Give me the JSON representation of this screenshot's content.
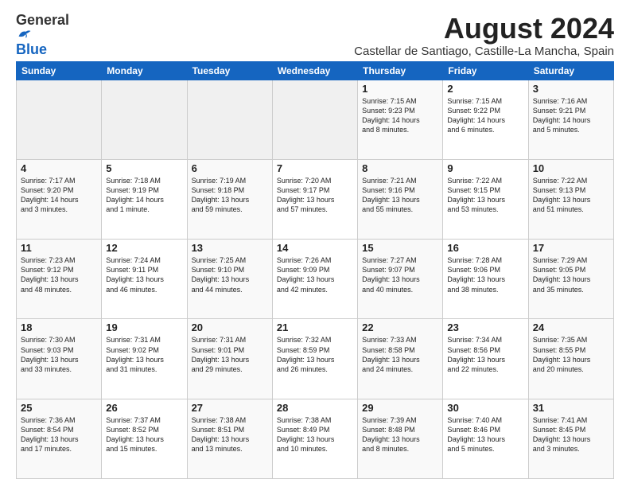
{
  "logo": {
    "general": "General",
    "blue": "Blue"
  },
  "title": "August 2024",
  "location": "Castellar de Santiago, Castille-La Mancha, Spain",
  "days_of_week": [
    "Sunday",
    "Monday",
    "Tuesday",
    "Wednesday",
    "Thursday",
    "Friday",
    "Saturday"
  ],
  "weeks": [
    [
      {
        "day": "",
        "info": ""
      },
      {
        "day": "",
        "info": ""
      },
      {
        "day": "",
        "info": ""
      },
      {
        "day": "",
        "info": ""
      },
      {
        "day": "1",
        "info": "Sunrise: 7:15 AM\nSunset: 9:23 PM\nDaylight: 14 hours\nand 8 minutes."
      },
      {
        "day": "2",
        "info": "Sunrise: 7:15 AM\nSunset: 9:22 PM\nDaylight: 14 hours\nand 6 minutes."
      },
      {
        "day": "3",
        "info": "Sunrise: 7:16 AM\nSunset: 9:21 PM\nDaylight: 14 hours\nand 5 minutes."
      }
    ],
    [
      {
        "day": "4",
        "info": "Sunrise: 7:17 AM\nSunset: 9:20 PM\nDaylight: 14 hours\nand 3 minutes."
      },
      {
        "day": "5",
        "info": "Sunrise: 7:18 AM\nSunset: 9:19 PM\nDaylight: 14 hours\nand 1 minute."
      },
      {
        "day": "6",
        "info": "Sunrise: 7:19 AM\nSunset: 9:18 PM\nDaylight: 13 hours\nand 59 minutes."
      },
      {
        "day": "7",
        "info": "Sunrise: 7:20 AM\nSunset: 9:17 PM\nDaylight: 13 hours\nand 57 minutes."
      },
      {
        "day": "8",
        "info": "Sunrise: 7:21 AM\nSunset: 9:16 PM\nDaylight: 13 hours\nand 55 minutes."
      },
      {
        "day": "9",
        "info": "Sunrise: 7:22 AM\nSunset: 9:15 PM\nDaylight: 13 hours\nand 53 minutes."
      },
      {
        "day": "10",
        "info": "Sunrise: 7:22 AM\nSunset: 9:13 PM\nDaylight: 13 hours\nand 51 minutes."
      }
    ],
    [
      {
        "day": "11",
        "info": "Sunrise: 7:23 AM\nSunset: 9:12 PM\nDaylight: 13 hours\nand 48 minutes."
      },
      {
        "day": "12",
        "info": "Sunrise: 7:24 AM\nSunset: 9:11 PM\nDaylight: 13 hours\nand 46 minutes."
      },
      {
        "day": "13",
        "info": "Sunrise: 7:25 AM\nSunset: 9:10 PM\nDaylight: 13 hours\nand 44 minutes."
      },
      {
        "day": "14",
        "info": "Sunrise: 7:26 AM\nSunset: 9:09 PM\nDaylight: 13 hours\nand 42 minutes."
      },
      {
        "day": "15",
        "info": "Sunrise: 7:27 AM\nSunset: 9:07 PM\nDaylight: 13 hours\nand 40 minutes."
      },
      {
        "day": "16",
        "info": "Sunrise: 7:28 AM\nSunset: 9:06 PM\nDaylight: 13 hours\nand 38 minutes."
      },
      {
        "day": "17",
        "info": "Sunrise: 7:29 AM\nSunset: 9:05 PM\nDaylight: 13 hours\nand 35 minutes."
      }
    ],
    [
      {
        "day": "18",
        "info": "Sunrise: 7:30 AM\nSunset: 9:03 PM\nDaylight: 13 hours\nand 33 minutes."
      },
      {
        "day": "19",
        "info": "Sunrise: 7:31 AM\nSunset: 9:02 PM\nDaylight: 13 hours\nand 31 minutes."
      },
      {
        "day": "20",
        "info": "Sunrise: 7:31 AM\nSunset: 9:01 PM\nDaylight: 13 hours\nand 29 minutes."
      },
      {
        "day": "21",
        "info": "Sunrise: 7:32 AM\nSunset: 8:59 PM\nDaylight: 13 hours\nand 26 minutes."
      },
      {
        "day": "22",
        "info": "Sunrise: 7:33 AM\nSunset: 8:58 PM\nDaylight: 13 hours\nand 24 minutes."
      },
      {
        "day": "23",
        "info": "Sunrise: 7:34 AM\nSunset: 8:56 PM\nDaylight: 13 hours\nand 22 minutes."
      },
      {
        "day": "24",
        "info": "Sunrise: 7:35 AM\nSunset: 8:55 PM\nDaylight: 13 hours\nand 20 minutes."
      }
    ],
    [
      {
        "day": "25",
        "info": "Sunrise: 7:36 AM\nSunset: 8:54 PM\nDaylight: 13 hours\nand 17 minutes."
      },
      {
        "day": "26",
        "info": "Sunrise: 7:37 AM\nSunset: 8:52 PM\nDaylight: 13 hours\nand 15 minutes."
      },
      {
        "day": "27",
        "info": "Sunrise: 7:38 AM\nSunset: 8:51 PM\nDaylight: 13 hours\nand 13 minutes."
      },
      {
        "day": "28",
        "info": "Sunrise: 7:38 AM\nSunset: 8:49 PM\nDaylight: 13 hours\nand 10 minutes."
      },
      {
        "day": "29",
        "info": "Sunrise: 7:39 AM\nSunset: 8:48 PM\nDaylight: 13 hours\nand 8 minutes."
      },
      {
        "day": "30",
        "info": "Sunrise: 7:40 AM\nSunset: 8:46 PM\nDaylight: 13 hours\nand 5 minutes."
      },
      {
        "day": "31",
        "info": "Sunrise: 7:41 AM\nSunset: 8:45 PM\nDaylight: 13 hours\nand 3 minutes."
      }
    ]
  ]
}
